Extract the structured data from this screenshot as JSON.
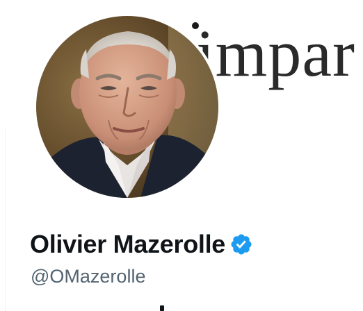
{
  "profile": {
    "banner_text": "impar",
    "display_name": "Olivier Mazerolle",
    "handle": "@OMazerolle",
    "verified_icon": "verified-badge-icon",
    "avatar_icon": "profile-photo"
  },
  "colors": {
    "name": "#0f1419",
    "handle": "#536471",
    "verified": "#1d9bf0"
  }
}
